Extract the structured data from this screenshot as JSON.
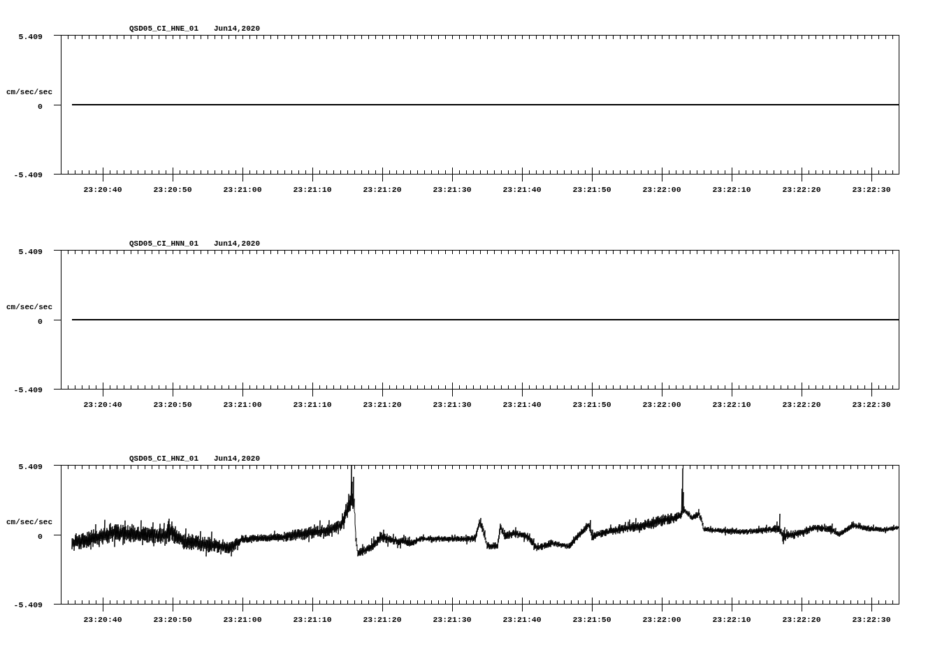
{
  "panels": [
    {
      "title": "QSD05_CI_HNE_01",
      "date": "Jun14,2020",
      "y_unit": "cm/sec/sec",
      "y_labels": [
        "5.409",
        "0",
        "-5.409"
      ],
      "x_labels": [
        "23:20:40",
        "23:20:50",
        "23:21:00",
        "23:21:10",
        "23:21:20",
        "23:21:30",
        "23:21:40",
        "23:21:50",
        "23:22:00",
        "23:22:10",
        "23:22:20",
        "23:22:30"
      ],
      "trace": {
        "kind": "flat"
      }
    },
    {
      "title": "QSD05_CI_HNN_01",
      "date": "Jun14,2020",
      "y_unit": "cm/sec/sec",
      "y_labels": [
        "5.409",
        "0",
        "-5.409"
      ],
      "x_labels": [
        "23:20:40",
        "23:20:50",
        "23:21:00",
        "23:21:10",
        "23:21:20",
        "23:21:30",
        "23:21:40",
        "23:21:50",
        "23:22:00",
        "23:22:10",
        "23:22:20",
        "23:22:30"
      ],
      "trace": {
        "kind": "flat"
      }
    },
    {
      "title": "QSD05_CI_HNZ_01",
      "date": "Jun14,2020",
      "y_unit": "cm/sec/sec",
      "y_labels": [
        "5.409",
        "0",
        "-5.409"
      ],
      "x_labels": [
        "23:20:40",
        "23:20:50",
        "23:21:00",
        "23:21:10",
        "23:21:20",
        "23:21:30",
        "23:21:40",
        "23:21:50",
        "23:22:00",
        "23:22:10",
        "23:22:20",
        "23:22:30"
      ],
      "trace": {
        "kind": "waveform"
      }
    }
  ]
}
